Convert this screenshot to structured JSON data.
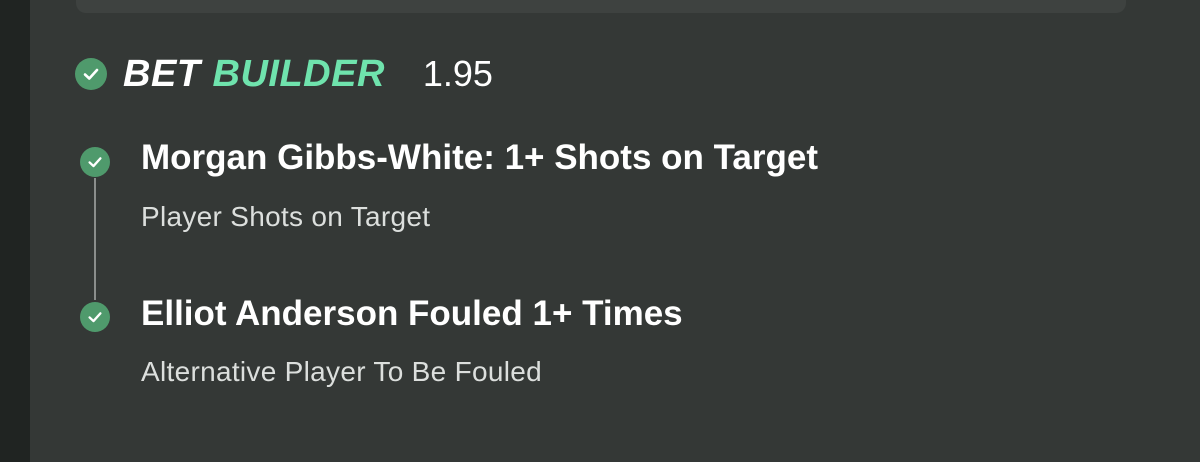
{
  "bet_builder": {
    "brand_word_1": "BET",
    "brand_word_2": "BUILDER",
    "odds": "1.95",
    "selections": [
      {
        "title": "Morgan Gibbs-White: 1+ Shots on Target",
        "market": "Player Shots on Target",
        "status_icon": "check-circle-icon"
      },
      {
        "title": "Elliot Anderson Fouled 1+ Times",
        "market": "Alternative Player To Be Fouled",
        "status_icon": "check-circle-icon"
      }
    ]
  },
  "colors": {
    "background": "#202422",
    "card": "#343836",
    "accent_green": "#6fe3ad",
    "check_green": "#4f9a6c",
    "text_primary": "#ffffff",
    "text_secondary": "#dcdfdd"
  }
}
